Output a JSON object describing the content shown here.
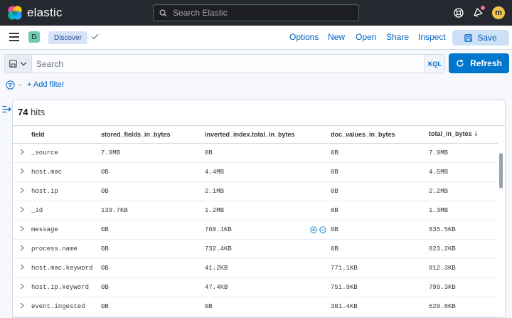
{
  "header": {
    "brand": "elastic",
    "search_placeholder": "Search Elastic",
    "avatar_initial": "m"
  },
  "appbar": {
    "space_initial": "D",
    "breadcrumb": "Discover",
    "links": [
      "Options",
      "New",
      "Open",
      "Share",
      "Inspect"
    ],
    "save_label": "Save"
  },
  "query": {
    "placeholder": "Search",
    "language": "KQL",
    "refresh_label": "Refresh",
    "add_filter_label": "+ Add filter"
  },
  "results": {
    "hits_count": "74",
    "hits_label": " hits",
    "columns": [
      "field",
      "stored_fields_in_bytes",
      "inverted_index.total_in_bytes",
      "doc_values_in_bytes",
      "total_in_bytes"
    ],
    "rows": [
      [
        "_source",
        "7.9MB",
        "0B",
        "0B",
        "7.9MB"
      ],
      [
        "host.mac",
        "0B",
        "4.4MB",
        "0B",
        "4.5MB"
      ],
      [
        "host.ip",
        "0B",
        "2.1MB",
        "0B",
        "2.2MB"
      ],
      [
        "_id",
        "139.7KB",
        "1.2MB",
        "0B",
        "1.3MB"
      ],
      [
        "message",
        "0B",
        "760.1KB",
        "0B",
        "835.5KB"
      ],
      [
        "process.name",
        "0B",
        "732.4KB",
        "0B",
        "823.2KB"
      ],
      [
        "host.mac.keyword",
        "0B",
        "41.2KB",
        "771.1KB",
        "812.3KB"
      ],
      [
        "host.ip.keyword",
        "0B",
        "47.4KB",
        "751.9KB",
        "799.3KB"
      ],
      [
        "event.ingested",
        "0B",
        "0B",
        "301.4KB",
        "628.8KB"
      ]
    ]
  },
  "colors": {
    "header_bg": "#25282f",
    "link": "#0061c2",
    "primary": "#0077cc",
    "save_bg": "#cce1f5",
    "space_badge": "#6dccb1",
    "avatar": "#f1c34b",
    "notification_dot": "#f06e9b"
  },
  "icons": [
    "elastic-logo",
    "search-icon",
    "help-icon",
    "newsfeed-icon",
    "menu-icon",
    "checkmark-icon",
    "save-icon",
    "saved-query-icon",
    "refresh-icon",
    "filter-icon",
    "sidebar-toggle-icon",
    "chevron-right-icon",
    "sort-down-icon",
    "zoom-in-icon",
    "zoom-out-icon"
  ]
}
